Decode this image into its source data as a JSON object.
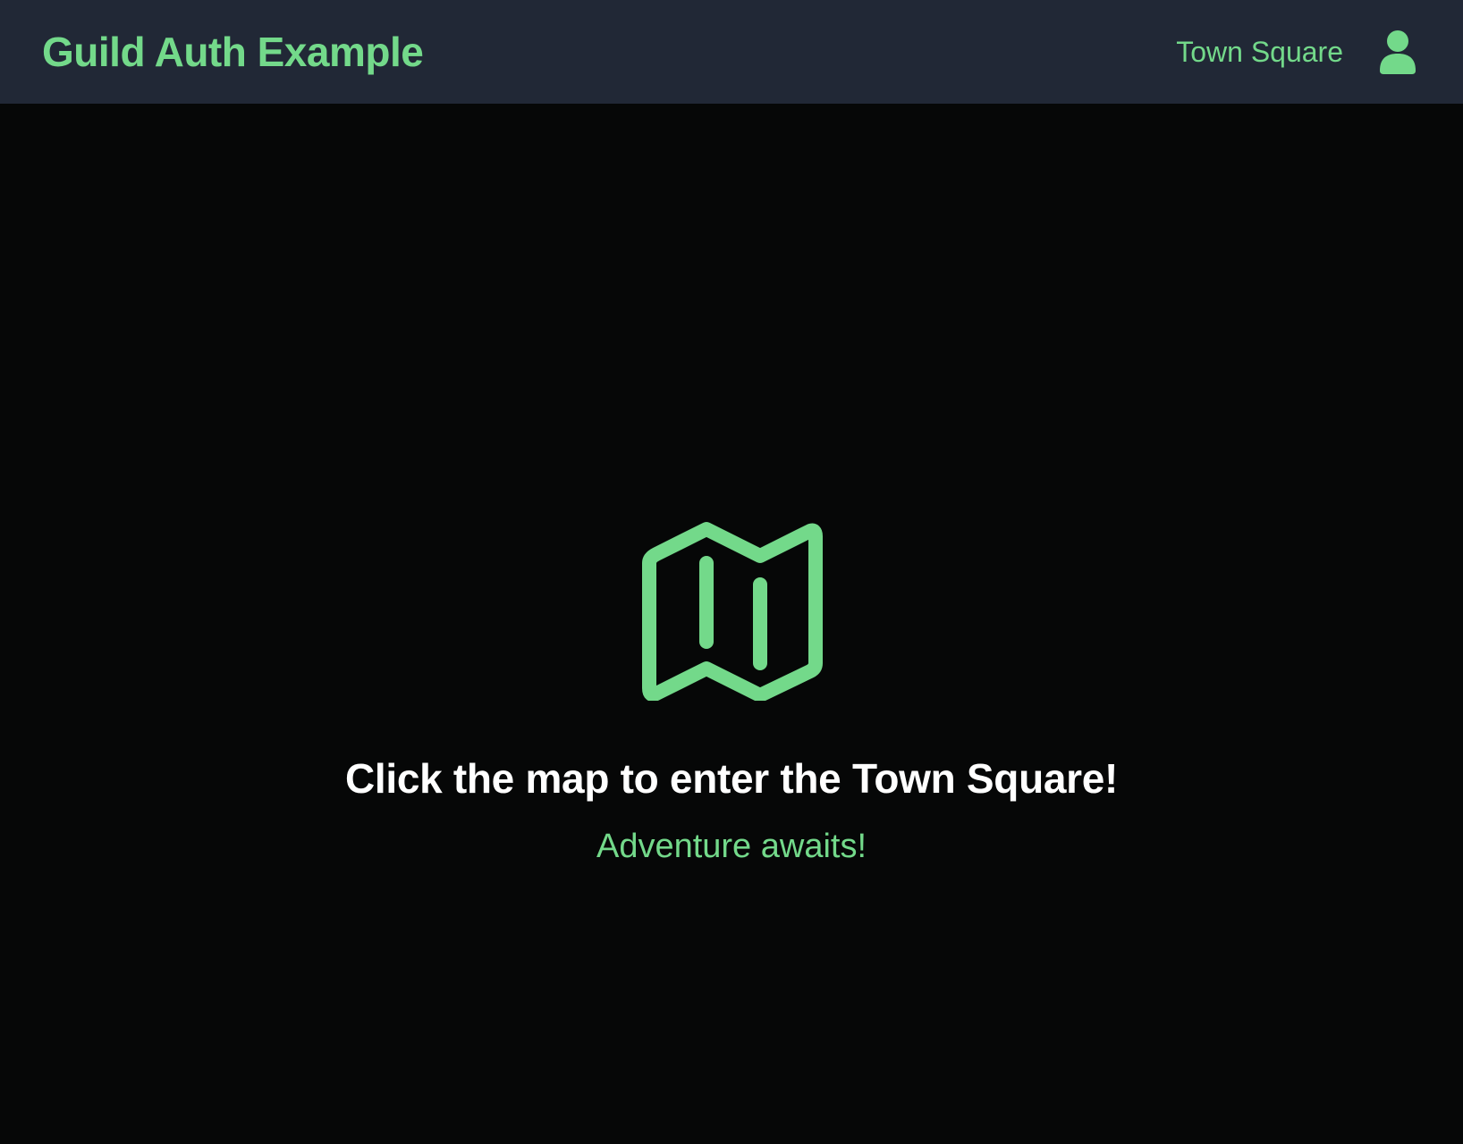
{
  "navbar": {
    "brand": "Guild Auth Example",
    "links": [
      {
        "label": "Town Square"
      }
    ],
    "user_icon": "user-icon"
  },
  "hero": {
    "icon": "map-icon",
    "title": "Click the map to enter the Town Square!",
    "subtitle": "Adventure awaits!"
  },
  "colors": {
    "accent": "#73d98a",
    "navbar_bg": "#212836",
    "page_bg": "#060707",
    "title_text": "#ffffff"
  }
}
